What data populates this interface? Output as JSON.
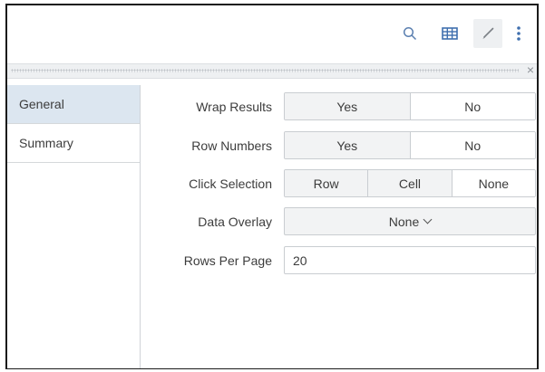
{
  "toolbar": {
    "icons": [
      "search-icon",
      "table-icon",
      "brush-icon",
      "more-vertical-icon"
    ]
  },
  "dragbar": {
    "close_label": "×"
  },
  "tabs": [
    {
      "label": "General",
      "active": true
    },
    {
      "label": "Summary",
      "active": false
    }
  ],
  "settings": {
    "wrap_results": {
      "label": "Wrap Results",
      "options": [
        "Yes",
        "No"
      ],
      "selected": "No"
    },
    "row_numbers": {
      "label": "Row Numbers",
      "options": [
        "Yes",
        "No"
      ],
      "selected": "No"
    },
    "click_selection": {
      "label": "Click Selection",
      "options": [
        "Row",
        "Cell",
        "None"
      ],
      "selected": "None"
    },
    "data_overlay": {
      "label": "Data Overlay",
      "value": "None"
    },
    "rows_per_page": {
      "label": "Rows Per Page",
      "value": "20"
    }
  },
  "colors": {
    "active_tab": "#dce6f0",
    "button_bg": "#f2f3f4",
    "selected_bg": "#ffffff",
    "icon_blue": "#5a7fb0"
  }
}
